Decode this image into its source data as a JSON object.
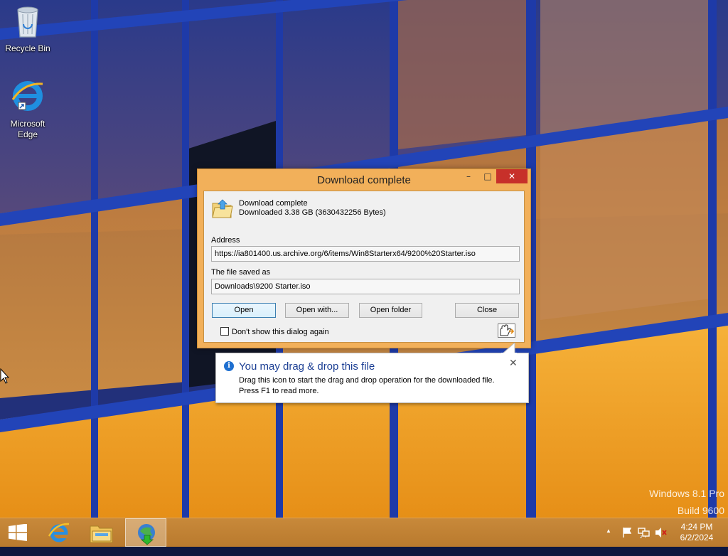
{
  "desktop": {
    "icons": [
      {
        "label": "Recycle Bin",
        "icon": "recycle-bin-icon"
      },
      {
        "label": "Microsoft Edge",
        "icon": "internet-explorer-icon"
      }
    ],
    "watermark": {
      "line1": "Windows 8.1 Pro",
      "line2": "Build 9600"
    }
  },
  "dialog": {
    "title": "Download complete",
    "titlebar_buttons": {
      "minimize": "–",
      "maximize": "□",
      "close": "✕"
    },
    "status_title": "Download complete",
    "status_detail": "Downloaded 3.38  GB (3630432256 Bytes)",
    "address_label": "Address",
    "address_value": "https://ia801400.us.archive.org/6/items/Win8Starterx64/9200%20Starter.iso",
    "saved_label": "The file saved as",
    "saved_value": "Downloads\\9200 Starter.iso",
    "buttons": {
      "open": "Open",
      "open_with": "Open with...",
      "open_folder": "Open folder",
      "close": "Close"
    },
    "checkbox_label": "Don't show this dialog again",
    "checkbox_checked": false,
    "icons": {
      "file": "folder-download-icon",
      "drag": "drag-drop-hand-icon"
    }
  },
  "balloon": {
    "title": "You may drag & drop this file",
    "line1": "Drag this icon to start the drag and drop operation for the downloaded file.",
    "line2": "Press F1 to read more.",
    "close_glyph": "✕",
    "info_glyph": "i"
  },
  "taskbar": {
    "items": [
      {
        "icon": "start-windows-icon"
      },
      {
        "icon": "internet-explorer-icon"
      },
      {
        "icon": "file-explorer-icon"
      },
      {
        "icon": "internet-download-manager-icon",
        "active": true
      }
    ],
    "tray": {
      "chevron": "▲",
      "icons": [
        "action-center-flag-icon",
        "network-icon",
        "volume-muted-icon"
      ]
    },
    "clock": {
      "time": "4:24 PM",
      "date": "6/2/2024"
    }
  },
  "colors": {
    "taskbar": "#c08235",
    "dialog_frame": "#f2b05a",
    "close_button": "#c7302a",
    "balloon_title": "#1c3f94"
  }
}
